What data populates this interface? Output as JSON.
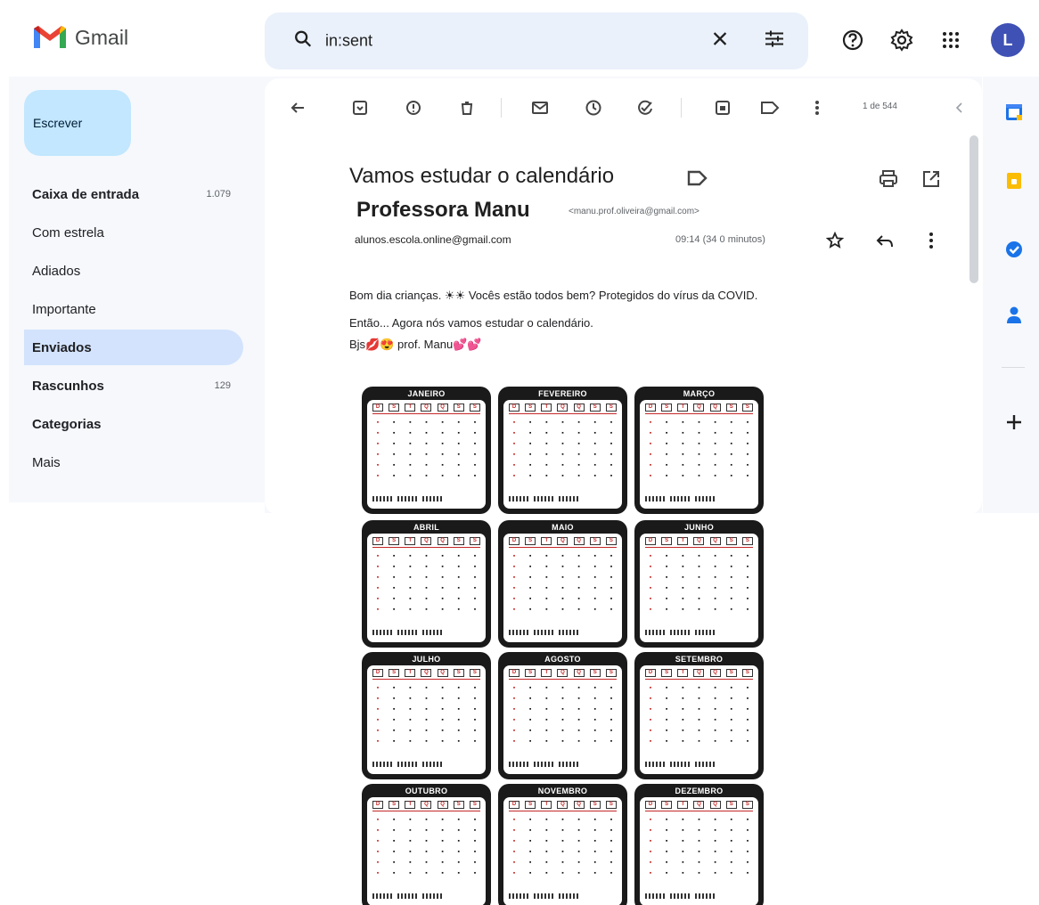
{
  "app": {
    "name": "Gmail"
  },
  "search": {
    "query": "in:sent"
  },
  "header_icons": [
    "search-icon",
    "close-icon",
    "filter-options-icon",
    "help-icon",
    "settings-icon",
    "apps-grid-icon"
  ],
  "user": {
    "avatar_letter": "L",
    "avatar_color": "#3f51b5"
  },
  "compose": {
    "label": "Escrever"
  },
  "nav": [
    {
      "label": "Caixa de entrada",
      "count": "1.079",
      "bold": true,
      "active": false
    },
    {
      "label": "Com estrela",
      "count": "",
      "bold": false,
      "active": false
    },
    {
      "label": "Adiados",
      "count": "",
      "bold": false,
      "active": false
    },
    {
      "label": "Importante",
      "count": "",
      "bold": false,
      "active": false
    },
    {
      "label": "Enviados",
      "count": "",
      "bold": true,
      "active": true
    },
    {
      "label": "Rascunhos",
      "count": "129",
      "bold": true,
      "active": false
    },
    {
      "label": "Categorias",
      "count": "",
      "bold": true,
      "active": false
    },
    {
      "label": "Mais",
      "count": "",
      "bold": false,
      "active": false
    }
  ],
  "toolbar": {
    "icons": [
      "back-icon",
      "archive-icon",
      "report-spam-icon",
      "delete-icon",
      "mark-unread-icon",
      "snooze-icon",
      "add-to-tasks-icon",
      "move-to-icon",
      "label-icon",
      "more-icon"
    ],
    "pagination": "1 de 544"
  },
  "message": {
    "subject": "Vamos estudar o calendário",
    "sender_name": "Professora Manu",
    "sender_email": "<manu.prof.oliveira@gmail.com>",
    "to": "alunos.escola.online@gmail.com",
    "time": "09:14 (34 0 minutos)",
    "body": [
      "Bom dia crianças. ☀☀ Vocês estão todos bem? Protegidos do vírus da COVID.",
      "Então... Agora nós vamos estudar o calendário.",
      "Bjs💋😍 prof. Manu💕💕"
    ]
  },
  "side_panel_icons": [
    "calendar-icon",
    "keep-icon",
    "tasks-icon",
    "contacts-icon",
    "add-icon"
  ],
  "calendar": {
    "weekday_headers": [
      "D",
      "S",
      "T",
      "Q",
      "Q",
      "S",
      "S"
    ],
    "months": [
      "JANEIRO",
      "FEVEREIRO",
      "MARÇO",
      "ABRIL",
      "MAIO",
      "JUNHO",
      "JULHO",
      "AGOSTO",
      "SETEMBRO",
      "OUTUBRO",
      "NOVEMBRO",
      "DEZEMBRO"
    ]
  }
}
